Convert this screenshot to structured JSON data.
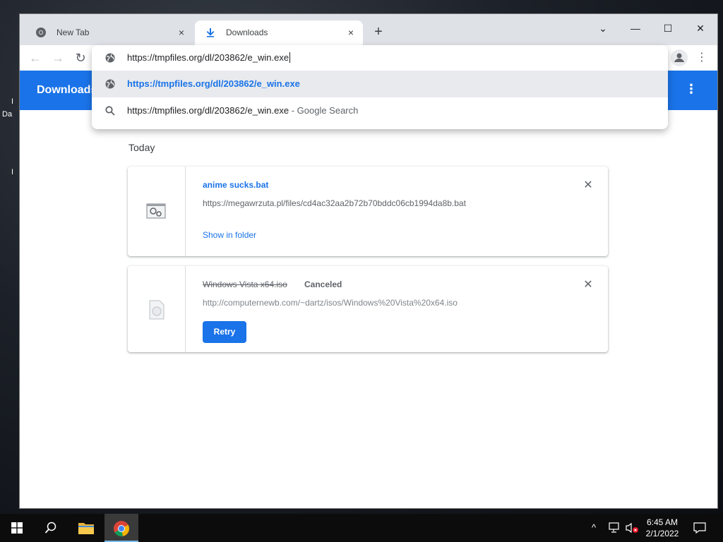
{
  "desktop": {
    "left_labels": [
      "I",
      "Da",
      "I",
      "I"
    ]
  },
  "tabs": [
    {
      "label": "New Tab",
      "close": "×"
    },
    {
      "label": "Downloads",
      "close": "×"
    }
  ],
  "new_tab_symbol": "+",
  "window_controls": {
    "dropdown": "⌄",
    "minimize": "—",
    "maximize": "☐",
    "close": "✕"
  },
  "toolbar": {
    "back": "←",
    "forward": "→",
    "reload": "↻",
    "menu": "⋮"
  },
  "omnibox": {
    "typed": "https://tmpfiles.org/dl/203862/e_win.exe",
    "suggestions": [
      {
        "text": "https://tmpfiles.org/dl/203862/e_win.exe",
        "suffix": ""
      },
      {
        "text": "https://tmpfiles.org/dl/203862/e_win.exe",
        "suffix": " - Google Search"
      }
    ]
  },
  "page": {
    "title": "Downloads",
    "menu": "⋮",
    "section_date": "Today",
    "downloads": [
      {
        "name": "anime sucks.bat",
        "url": "https://megawrzuta.pl/files/cd4ac32aa2b72b70bddc06cb1994da8b.bat",
        "action": "Show in folder",
        "close": "✕"
      },
      {
        "name": "Windows Vista x64.iso",
        "status": "Canceled",
        "url": "http://computernewb.com/~dartz/isos/Windows%20Vista%20x64.iso",
        "action": "Retry",
        "close": "✕"
      }
    ]
  },
  "taskbar": {
    "time": "6:45 AM",
    "date": "2/1/2022",
    "tray_chevron": "^"
  },
  "colors": {
    "accent": "#1a73e8",
    "titlebar": "#dee1e6",
    "taskbar": "#0c0c0c"
  }
}
